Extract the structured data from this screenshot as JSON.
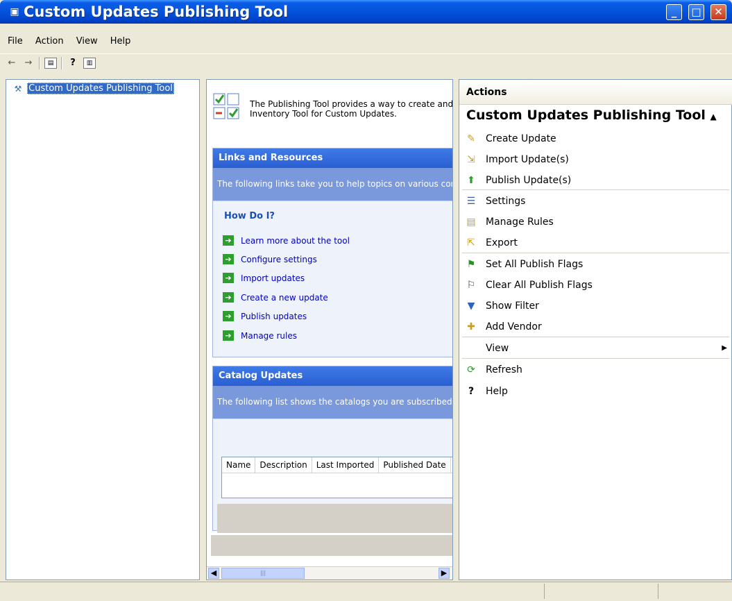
{
  "window": {
    "title": "Custom Updates Publishing Tool",
    "icon": "app-icon",
    "controls": [
      "minimize",
      "maximize",
      "close"
    ]
  },
  "menubar": {
    "items": [
      {
        "label": "File",
        "accel": "F"
      },
      {
        "label": "Action",
        "accel": "A"
      },
      {
        "label": "View",
        "accel": "V"
      },
      {
        "label": "Help",
        "accel": "H"
      }
    ]
  },
  "toolbar": {
    "buttons": [
      "back-arrow-icon",
      "forward-arrow-icon",
      "show-hide-console-tree-icon",
      "help-icon",
      "show-hide-action-pane-icon"
    ]
  },
  "tree": {
    "root_label": "Custom Updates Publishing Tool"
  },
  "intro": {
    "line1": "The Publishing Tool provides a way to create and",
    "line2": "Inventory Tool for Custom Updates."
  },
  "links_panel": {
    "header": "Links and Resources",
    "description": "The following links take you to help topics on various common tasks.",
    "howdoi": "How Do I?",
    "links": [
      "Learn more about the tool",
      "Configure settings",
      "Import updates",
      "Create a new update",
      "Publish updates",
      "Manage rules"
    ]
  },
  "catalog_panel": {
    "header": "Catalog Updates",
    "description": "The following list shows the catalogs you are subscribed to.",
    "columns": [
      "Name",
      "Description",
      "Last Imported",
      "Published Date"
    ]
  },
  "actions": {
    "title": "Actions",
    "group": "Custom Updates Publishing Tool",
    "items": [
      {
        "label": "Create Update",
        "icon": "create-update-icon"
      },
      {
        "label": "Import Update(s)",
        "icon": "import-update-icon"
      },
      {
        "label": "Publish Update(s)",
        "icon": "publish-update-icon"
      },
      {
        "label": "Settings",
        "icon": "settings-icon"
      },
      {
        "label": "Manage Rules",
        "icon": "manage-rules-icon"
      },
      {
        "label": "Export",
        "icon": "export-icon"
      },
      {
        "label": "Set All Publish Flags",
        "icon": "set-flags-icon"
      },
      {
        "label": "Clear All Publish Flags",
        "icon": "clear-flags-icon"
      },
      {
        "label": "Show Filter",
        "icon": "filter-icon"
      },
      {
        "label": "Add Vendor",
        "icon": "add-vendor-icon"
      },
      {
        "label": "View",
        "icon": ""
      },
      {
        "label": "Refresh",
        "icon": "refresh-icon"
      },
      {
        "label": "Help",
        "icon": "help-icon"
      }
    ]
  }
}
